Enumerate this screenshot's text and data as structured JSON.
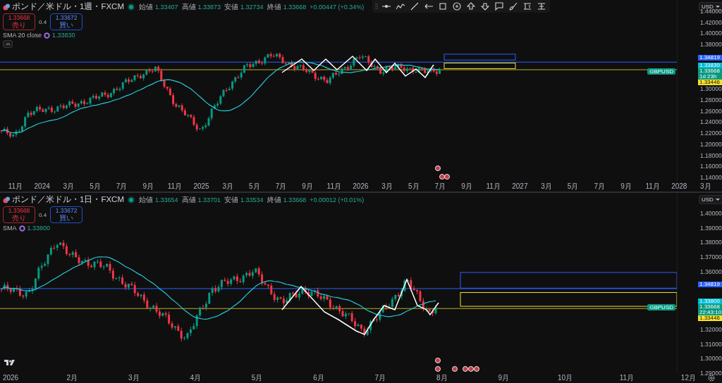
{
  "panes": [
    {
      "title": "ポンド／米ドル・1週・FXCM",
      "market_open": true,
      "ohlc": [
        {
          "label": "始値",
          "value": "1.33407"
        },
        {
          "label": "高値",
          "value": "1.33873"
        },
        {
          "label": "安値",
          "value": "1.32734"
        },
        {
          "label": "終値",
          "value": "1.33668"
        }
      ],
      "change": "+0.00447 (+0.34%)",
      "sell": {
        "price": "1.33668",
        "label": "売り"
      },
      "spread": "0.4",
      "buy": {
        "price": "1.33672",
        "label": "買い"
      },
      "indicator": {
        "name": "SMA 20 close",
        "value": "1.33830"
      },
      "currency": "USD",
      "price_ticks": [
        "1.44000",
        "1.42000",
        "1.40000",
        "1.38000",
        "1.30000",
        "1.28000",
        "1.26000",
        "1.24000",
        "1.22000",
        "1.20000",
        "1.18000",
        "1.16000",
        "1.14000"
      ],
      "price_markers": [
        {
          "value": "1.34819",
          "color": "#2962ff"
        },
        {
          "value": "1.33830",
          "color": "#00bcd4"
        },
        {
          "value": "1.33668",
          "sub": "1d 23h",
          "color": "#089981"
        },
        {
          "value": "1.33446",
          "color": "#f5e12c"
        }
      ],
      "symbol_tag": "GBPUSD",
      "time_labels": [
        "11月",
        "2024",
        "3月",
        "5月",
        "7月",
        "9月",
        "11月",
        "2025",
        "3月",
        "5月",
        "7月",
        "9月",
        "11月",
        "2026",
        "3月",
        "5月",
        "7月",
        "9月",
        "11月",
        "2027",
        "3月",
        "5月",
        "7月",
        "9月",
        "11月",
        "2028",
        "3月"
      ]
    },
    {
      "title": "ポンド／米ドル・1日・FXCM",
      "market_open": true,
      "ohlc": [
        {
          "label": "始値",
          "value": "1.33654"
        },
        {
          "label": "高値",
          "value": "1.33701"
        },
        {
          "label": "安値",
          "value": "1.33534"
        },
        {
          "label": "終値",
          "value": "1.33668"
        }
      ],
      "change": "+0.00012 (+0.01%)",
      "sell": {
        "price": "1.33668",
        "label": "売り"
      },
      "spread": "0.4",
      "buy": {
        "price": "1.33672",
        "label": "買い"
      },
      "indicator": {
        "name": "SMA",
        "value": "1.33800"
      },
      "currency": "USD",
      "price_ticks": [
        "1.40000",
        "1.39000",
        "1.38000",
        "1.37000",
        "1.36000",
        "1.32000",
        "1.31000",
        "1.30000",
        "1.29000"
      ],
      "price_markers": [
        {
          "value": "1.34819",
          "color": "#2962ff"
        },
        {
          "value": "1.33800",
          "color": "#00bcd4"
        },
        {
          "value": "1.33668",
          "sub": "22:43:10",
          "color": "#089981"
        },
        {
          "value": "1.33446",
          "color": "#f5e12c"
        }
      ],
      "symbol_tag": "GBPUSD",
      "time_labels": [
        "2026",
        "2月",
        "3月",
        "4月",
        "5月",
        "6月",
        "7月",
        "8月",
        "9月",
        "10月",
        "11月",
        "12月"
      ]
    }
  ]
}
